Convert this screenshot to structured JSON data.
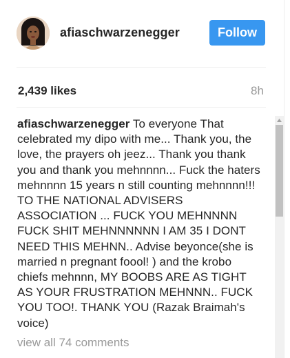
{
  "post": {
    "username": "afiaschwarzenegger",
    "follow_label": "Follow",
    "likes": "2,439 likes",
    "time": "8h",
    "caption_author": "afiaschwarzenegger",
    "caption_text": "To everyone That celebrated my dipo with me... Thank you, the love, the prayers oh jeez... Thank you thank you and thank you mehnnnn... Fuck the haters mehnnnn 15 years n still counting mehnnnn!!! TO THE NATIONAL ADVISERS ASSOCIATION ... FUCK YOU MEHNNNN FUCK SHIT MEHNNNNNN I AM 35 I DONT NEED THIS MEHNN.. Advise beyonce(she is married n pregnant foool! ) and the krobo chiefs mehnnn, MY BOOBS ARE AS TIGHT AS YOUR FRUSTRATION MEHNNN.. FUCK YOU TOO!. THANK YOU (Razak Braimah's voice)",
    "view_comments": "view all 74 comments"
  },
  "colors": {
    "accent": "#3897f0",
    "text": "#262626",
    "muted": "#999999"
  },
  "icons": {
    "scroll_up": "triangle-up-icon"
  }
}
